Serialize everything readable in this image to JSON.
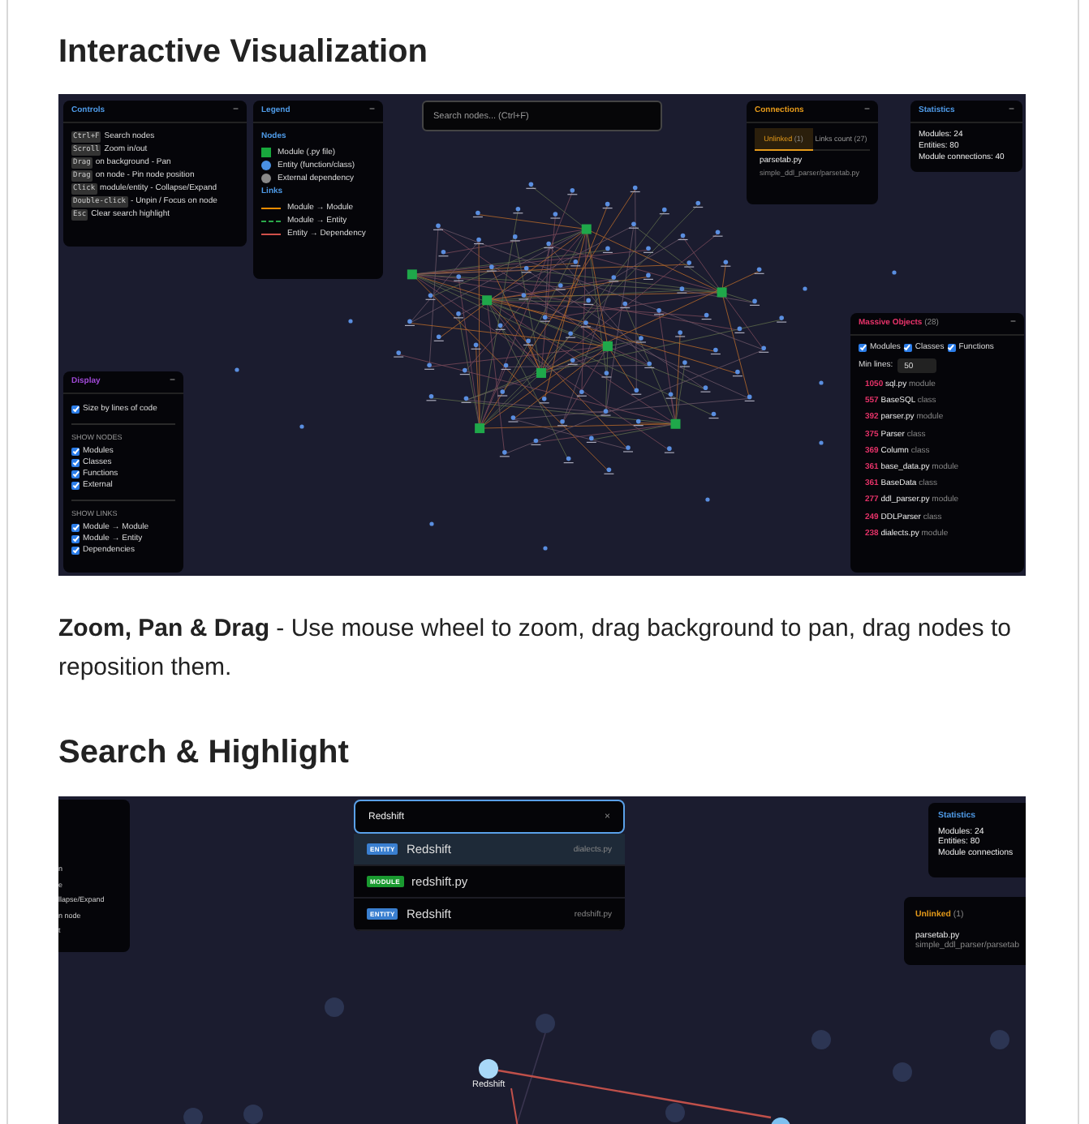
{
  "sections": [
    {
      "heading": "Interactive Visualization"
    },
    {
      "heading": "Search & Highlight"
    }
  ],
  "shot1": {
    "controls": {
      "title": "Controls",
      "collapse": "−",
      "rows": [
        {
          "key": "Ctrl+F",
          "text": "Search nodes"
        },
        {
          "key": "Scroll",
          "text": "Zoom in/out"
        },
        {
          "key": "Drag",
          "text": "on background - Pan"
        },
        {
          "key": "Drag",
          "text": "on node - Pin node position"
        },
        {
          "key": "Click",
          "text": "module/entity - Collapse/Expand"
        },
        {
          "key": "Double-click",
          "text": "- Unpin / Focus on node"
        },
        {
          "key": "Esc",
          "text": "Clear search highlight"
        }
      ]
    },
    "legend": {
      "title": "Legend",
      "collapse": "−",
      "nodes_label": "Nodes",
      "nodes": [
        {
          "kind": "module",
          "label": "Module (.py file)"
        },
        {
          "kind": "entity",
          "label": "Entity (function/class)"
        },
        {
          "kind": "external",
          "label": "External dependency"
        }
      ],
      "links_label": "Links",
      "links": [
        {
          "kind": "module",
          "label": "Module → Module"
        },
        {
          "kind": "entity",
          "label": "Module → Entity"
        },
        {
          "kind": "dependency",
          "label": "Entity → Dependency"
        }
      ]
    },
    "search": {
      "placeholder": "Search nodes... (Ctrl+F)"
    },
    "connections": {
      "title": "Connections",
      "collapse": "−",
      "tabs": [
        {
          "label": "Unlinked",
          "count": "(1)",
          "selected": true
        },
        {
          "label": "Links count",
          "count": "(27)",
          "selected": false
        }
      ],
      "items": [
        {
          "name": "parsetab.py",
          "path": "simple_ddl_parser/parsetab.py"
        }
      ]
    },
    "statistics": {
      "title": "Statistics",
      "collapse": "−",
      "lines": [
        "Modules: 24",
        "Entities: 80",
        "Module connections: 40"
      ]
    },
    "massive": {
      "title": "Massive Objects",
      "count": "(28)",
      "collapse": "−",
      "filters": [
        {
          "label": "Modules",
          "checked": true
        },
        {
          "label": "Classes",
          "checked": true
        },
        {
          "label": "Functions",
          "checked": true
        }
      ],
      "min_label": "Min lines:",
      "min_value": "50",
      "items": [
        {
          "lines": "1050",
          "name": "sql.py",
          "type": "module"
        },
        {
          "lines": "557",
          "name": "BaseSQL",
          "type": "class"
        },
        {
          "lines": "392",
          "name": "parser.py",
          "type": "module"
        },
        {
          "lines": "375",
          "name": "Parser",
          "type": "class"
        },
        {
          "lines": "369",
          "name": "Column",
          "type": "class"
        },
        {
          "lines": "361",
          "name": "base_data.py",
          "type": "module"
        },
        {
          "lines": "361",
          "name": "BaseData",
          "type": "class"
        },
        {
          "lines": "277",
          "name": "ddl_parser.py",
          "type": "module"
        },
        {
          "lines": "249",
          "name": "DDLParser",
          "type": "class"
        },
        {
          "lines": "238",
          "name": "dialects.py",
          "type": "module"
        }
      ]
    },
    "display": {
      "title": "Display",
      "collapse": "−",
      "groups": [
        {
          "items": [
            {
              "label": "Size by lines of code",
              "checked": true
            }
          ]
        },
        {
          "title": "SHOW NODES",
          "items": [
            {
              "label": "Modules",
              "checked": true
            },
            {
              "label": "Classes",
              "checked": true
            },
            {
              "label": "Functions",
              "checked": true
            },
            {
              "label": "External",
              "checked": true
            }
          ]
        },
        {
          "title": "SHOW LINKS",
          "items": [
            {
              "label": "Module → Module",
              "checked": true
            },
            {
              "label": "Module → Entity",
              "checked": true
            },
            {
              "label": "Dependencies",
              "checked": true
            }
          ]
        }
      ]
    }
  },
  "paragraph": "**Zoom, Pan & Drag** - Use mouse wheel to zoom, drag background to pan, drag nodes to reposition them.",
  "shot2": {
    "controls_fragments": [
      "n",
      "e",
      "llapse/Expand",
      "n node",
      "t"
    ],
    "search": {
      "value": "Redshift",
      "clear": "×"
    },
    "results": [
      {
        "kind": "entity",
        "badge": "ENTITY",
        "name": "Redshift",
        "file": "dialects.py",
        "selected": true
      },
      {
        "kind": "module",
        "badge": "MODULE",
        "name": "redshift.py",
        "selected": false
      },
      {
        "kind": "entity",
        "badge": "ENTITY",
        "name": "Redshift",
        "file": "redshift.py",
        "selected": false
      }
    ],
    "statistics": {
      "title": "Statistics",
      "lines": [
        "Modules: 24",
        "Entities: 80",
        "Module connections"
      ]
    },
    "unlinked": {
      "title": "Unlinked",
      "count": "(1)",
      "name": "parsetab.py",
      "path": "simple_ddl_parser/parsetab"
    },
    "node_label": "Redshift"
  }
}
